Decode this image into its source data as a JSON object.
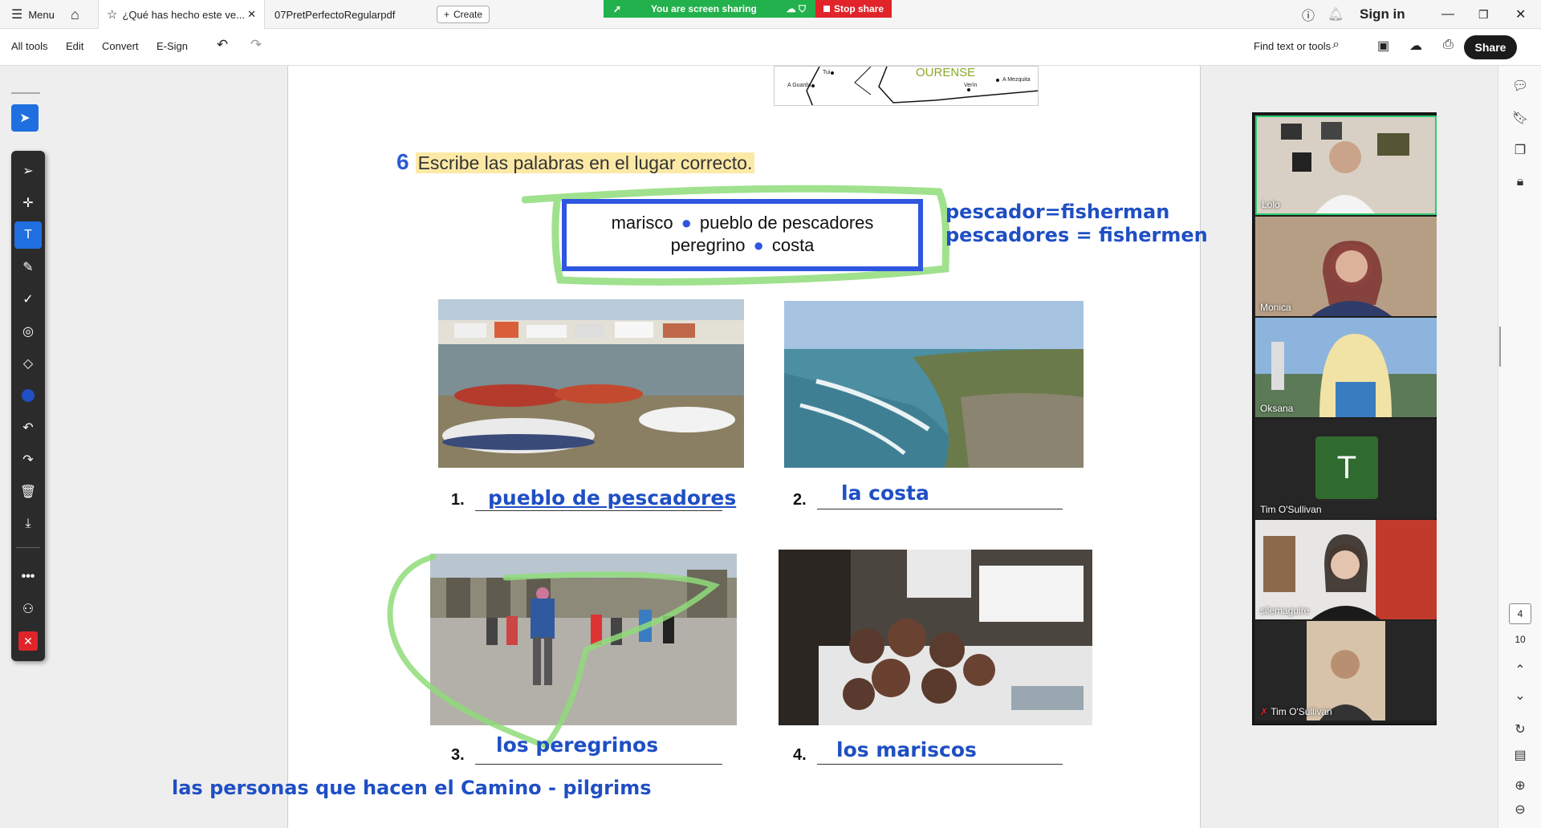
{
  "tabs": {
    "menu_label": "Menu",
    "active_tab": "¿Qué has hecho este ve...",
    "second_tab": "07PretPerfectoRegularpdf",
    "create_label": "Create"
  },
  "screen_share": {
    "status": "You are screen sharing",
    "stop_label": "Stop share"
  },
  "window": {
    "sign_in": "Sign in"
  },
  "toolbar": {
    "items": [
      "All tools",
      "Edit",
      "Convert",
      "E-Sign"
    ],
    "find_label": "Find text or tools",
    "share_label": "Share"
  },
  "map": {
    "region_label": "OURENSE",
    "place_1": "A Guarda",
    "place_2": "Tui",
    "place_3": "Verín",
    "place_4": "A Mezquita"
  },
  "exercise": {
    "number": "6",
    "instruction": "Escribe las palabras en el lugar correcto.",
    "word_line_1": [
      "marisco",
      "pueblo de pescadores"
    ],
    "word_line_2": [
      "peregrino",
      "costa"
    ],
    "note_1": "pescador=fisherman",
    "note_2": "pescadores = fishermen",
    "items": [
      {
        "num": "1.",
        "answer": "pueblo de pescadores"
      },
      {
        "num": "2.",
        "answer": "la costa"
      },
      {
        "num": "3.",
        "answer": "los peregrinos"
      },
      {
        "num": "4.",
        "answer": "los mariscos"
      }
    ],
    "footer_note": "las personas que hacen el Camino - pilgrims"
  },
  "participants": [
    {
      "name": "Lolo"
    },
    {
      "name": "Monica"
    },
    {
      "name": "Oksana"
    },
    {
      "name": "Tim O'Sullivan",
      "initial": "T"
    },
    {
      "name": "silemaguire"
    },
    {
      "name": "Tim O'Sullivan"
    }
  ],
  "page_nav": {
    "current": "4",
    "total": "10"
  },
  "colors": {
    "annotation_blue": "#1f4fc4",
    "highlight_green": "#8fdc7a",
    "share_green": "#22b14c",
    "stop_red": "#e0242a"
  }
}
